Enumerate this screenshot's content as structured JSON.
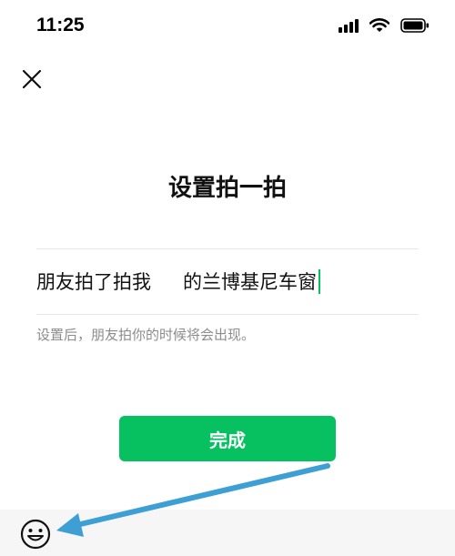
{
  "status_bar": {
    "time": "11:25",
    "icons": [
      "cellular-signal-icon",
      "wifi-icon",
      "battery-icon"
    ]
  },
  "header": {
    "close_icon": "close-icon"
  },
  "main": {
    "title": "设置拍一拍",
    "pat_prefix": "朋友拍了拍我",
    "pat_suffix_value": "的兰博基尼车窗",
    "hint": "设置后，朋友拍你的时候将会出现。",
    "done_label": "完成"
  },
  "bottom_bar": {
    "emoji_icon": "smiley-face-icon"
  },
  "colors": {
    "accent": "#07c160",
    "hint_text": "#8c8c8c",
    "annotation_arrow": "#3d9fd4",
    "bottom_bar_bg": "#f6f6f6"
  }
}
